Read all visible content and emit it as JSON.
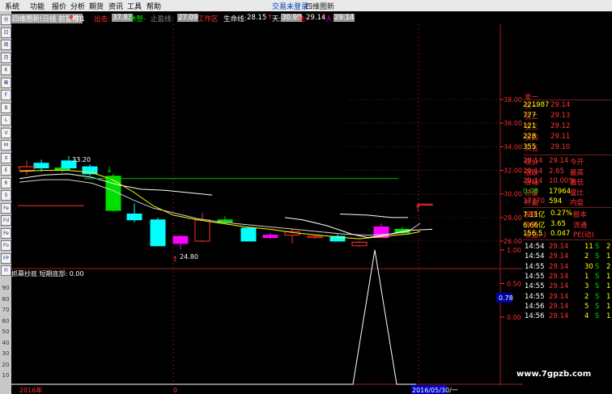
{
  "menu": {
    "items": [
      "系统",
      "功能",
      "报价",
      "分析",
      "期货",
      "资讯",
      "工具",
      "帮助"
    ],
    "trade_login": "交易未登录",
    "app_name": "四维图新"
  },
  "toolbar": {
    "tools": [
      "分",
      "日",
      "周",
      "月",
      "K",
      "画",
      "F",
      "B",
      "L",
      "V",
      "M",
      "X",
      "E",
      "R",
      "S",
      "Fe",
      "Fd",
      "Fe",
      "Fo",
      "FP",
      "Fi"
    ],
    "side_numbers": [
      "90",
      "80",
      "70",
      "60",
      "50",
      "40",
      "30",
      "20",
      "10"
    ]
  },
  "info": {
    "title": "四维图新(日线 前复权)",
    "indicator": "牛1",
    "sell_label": "出击:",
    "sell_value": "37.83",
    "hold_label": "休整-",
    "stop_label": "止盈线:",
    "stop_value": "27.09",
    "work_label": "工作区",
    "life_label": "生命线:",
    "life_value": "28.15",
    "day_label": "天:",
    "day_value": "30.99",
    "di_label": "地:",
    "di_value": "29.14",
    "ren_label": "人:",
    "ren_value": "29.14"
  },
  "axis": {
    "price_ticks": [
      "38.00",
      "36.00",
      "34.00",
      "32.00",
      "30.00",
      "28.00",
      "26.00"
    ],
    "sub_ticks": [
      "1.00",
      "0.50",
      "0.00"
    ],
    "left_date": "2016年",
    "mid_date": "0",
    "right_date": "2016/05/30/一",
    "crosshair_value": "0.78"
  },
  "chart_data": {
    "type": "candlestick",
    "annotations": [
      {
        "text": "33.20",
        "price": 33.2
      },
      {
        "text": "24.80",
        "price": 24.8
      }
    ],
    "sub_title": "抓幕抄底 短期底部: 0.00",
    "sub_peak": 1.0
  },
  "quote": {
    "asks": [
      {
        "label": "卖一",
        "price": "",
        "vol": ""
      }
    ],
    "bids": [
      {
        "label": "买一",
        "price": "29.14",
        "vol": "221987"
      },
      {
        "label": "买二",
        "price": "29.13",
        "vol": "777"
      },
      {
        "label": "买三",
        "price": "29.12",
        "vol": "121"
      },
      {
        "label": "买四",
        "price": "29.11",
        "vol": "228"
      },
      {
        "label": "买五",
        "price": "29.10",
        "vol": "355"
      }
    ],
    "stats": [
      {
        "l1": "现价",
        "v1": "29.14",
        "l2": "今开",
        "v2": "29.14"
      },
      {
        "l1": "涨跌",
        "v1": "2.65",
        "l2": "最高",
        "v2": "29.14"
      },
      {
        "l1": "涨幅",
        "v1": "10.00%",
        "l2": "最低",
        "v2": "29.14"
      },
      {
        "l1": "总量",
        "v1": "17964",
        "l2": "量比",
        "v2": "0.08"
      },
      {
        "l1": "外盘",
        "v1": "594",
        "l2": "内盘",
        "v2": "17370"
      }
    ],
    "fin": [
      {
        "l1": "换手",
        "v1": "0.27%",
        "l2": "股本",
        "v2": "7.11亿"
      },
      {
        "l1": "净资",
        "v1": "3.65",
        "l2": "流通",
        "v2": "6.66亿"
      },
      {
        "l1": "收益(-)",
        "v1": "0.047",
        "l2": "PE(动)",
        "v2": "156.5"
      }
    ],
    "ticks": [
      {
        "t": "14:54",
        "p": "29.14",
        "v": "11",
        "s": "S",
        "n": "2"
      },
      {
        "t": "14:54",
        "p": "29.14",
        "v": "2",
        "s": "S",
        "n": "1"
      },
      {
        "t": "14:55",
        "p": "29.14",
        "v": "30",
        "s": "S",
        "n": "2"
      },
      {
        "t": "14:55",
        "p": "29.14",
        "v": "1",
        "s": "S",
        "n": "1"
      },
      {
        "t": "14:55",
        "p": "29.14",
        "v": "3",
        "s": "S",
        "n": "1"
      },
      {
        "t": "14:55",
        "p": "29.14",
        "v": "2",
        "s": "S",
        "n": "1"
      },
      {
        "t": "14:56",
        "p": "29.14",
        "v": "5",
        "s": "S",
        "n": "1"
      },
      {
        "t": "14:56",
        "p": "29.14",
        "v": "4",
        "s": "S",
        "n": "1"
      }
    ]
  },
  "watermark": "www.7gpzb.com",
  "colors": {
    "up": "#ff3030",
    "down": "#00ffff",
    "magenta": "#ff00ff",
    "green": "#00e000",
    "white": "#ffffff",
    "yellow": "#ffff00",
    "grid": "#7a1a1a"
  }
}
